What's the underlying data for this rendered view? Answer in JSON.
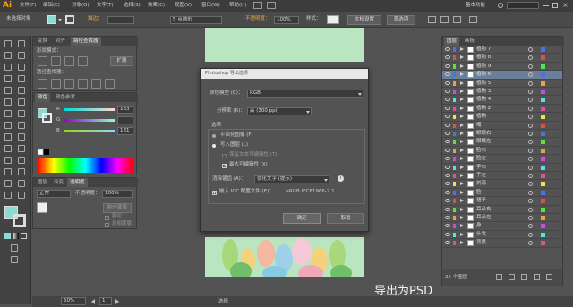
{
  "app": {
    "logo": "Ai",
    "menus": [
      "文件(F)",
      "编辑(E)",
      "对象(O)",
      "文字(T)",
      "选择(S)",
      "效果(C)",
      "视图(V)",
      "窗口(W)",
      "帮助(H)"
    ],
    "workspace": "基本功能",
    "icon_names": [
      "bridge-icon",
      "arrange-icon",
      "search-icon",
      "minimize-icon",
      "maximize-icon",
      "close-icon"
    ]
  },
  "control_bar": {
    "selection": "未选择对象",
    "stroke_label": "描边：",
    "stroke_width": "5 点圆形",
    "opacity_label": "不透明度：",
    "opacity_value": "100%",
    "style_label": "样式：",
    "doc_setup": "文档设置",
    "preferences": "首选项"
  },
  "align_panel": {
    "tabs": [
      "变换",
      "对齐",
      "路径查找器"
    ],
    "shape_modes_label": "形状模式：",
    "expand_button": "扩展",
    "pathfinder_label": "路径查找器："
  },
  "color_panel": {
    "tabs": [
      "颜色",
      "颜色参考"
    ],
    "channels": [
      {
        "name": "R",
        "value": "183"
      },
      {
        "name": "G",
        "value": ""
      },
      {
        "name": "B",
        "value": "181"
      }
    ]
  },
  "transparency_panel": {
    "tabs": [
      "图层",
      "渐变",
      "透明度"
    ],
    "blend_mode": "正常",
    "opacity_label": "不透明度：",
    "opacity_value": "100%",
    "make_mask": "制作蒙版",
    "clip": "剪切",
    "invert_mask": "反相蒙版"
  },
  "dialog": {
    "title": "Photoshop 导出选项",
    "color_model_label": "颜色模型 (C)：",
    "color_model_value": "RGB",
    "resolution_label": "分辨率 (R)：",
    "resolution_value": "高 (300 ppi)",
    "options_label": "选项",
    "flat_image": "平面化图像 (F)",
    "write_layers": "写入图层 (L)",
    "preserve_text": "保留文本可编辑性 (T)",
    "max_editability": "最大可编辑性 (X)",
    "antialias_label": "消除锯齿 (A)：",
    "antialias_value": "优化文字 (提示)",
    "embed_icc_label": "嵌入 ICC 配置文件 (E)：",
    "icc_profile": "sRGB IEC61966-2.1",
    "ok": "确定",
    "cancel": "取消"
  },
  "layers_panel": {
    "tabs": [
      "图层",
      "画板"
    ],
    "layers": [
      {
        "name": "植物 7",
        "color": "#4a72e8"
      },
      {
        "name": "植物 8",
        "color": "#e84a4a"
      },
      {
        "name": "植物 9",
        "color": "#4ae84a"
      },
      {
        "name": "植物 6",
        "color": "#4a72e8"
      },
      {
        "name": "植物 5",
        "color": "#e8a04a"
      },
      {
        "name": "植物 3",
        "color": "#c84ae8"
      },
      {
        "name": "植物 4",
        "color": "#4ae8e8"
      },
      {
        "name": "植物 2",
        "color": "#e84aa0"
      },
      {
        "name": "植物",
        "color": "#e8e84a"
      },
      {
        "name": "嘴",
        "color": "#e84a4a"
      },
      {
        "name": "眼睛右",
        "color": "#4a72e8"
      },
      {
        "name": "眼睛左",
        "color": "#4ae84a"
      },
      {
        "name": "脸右",
        "color": "#e8a04a"
      },
      {
        "name": "脸左",
        "color": "#c84ae8"
      },
      {
        "name": "手右",
        "color": "#4ae8e8"
      },
      {
        "name": "手左",
        "color": "#e84aa0"
      },
      {
        "name": "刘海",
        "color": "#e8e84a"
      },
      {
        "name": "脸",
        "color": "#4a72e8"
      },
      {
        "name": "裙子",
        "color": "#e84a4a"
      },
      {
        "name": "耳朵右",
        "color": "#4ae84a"
      },
      {
        "name": "耳朵左",
        "color": "#e8a04a"
      },
      {
        "name": "身",
        "color": "#c84ae8"
      },
      {
        "name": "头发",
        "color": "#4ae8e8"
      },
      {
        "name": "背景",
        "color": "#e84aa0"
      }
    ],
    "count": "25 个图层"
  },
  "status_bar": {
    "zoom": "50%",
    "page": "1",
    "tool": "选择"
  },
  "caption": "导出为PSD"
}
